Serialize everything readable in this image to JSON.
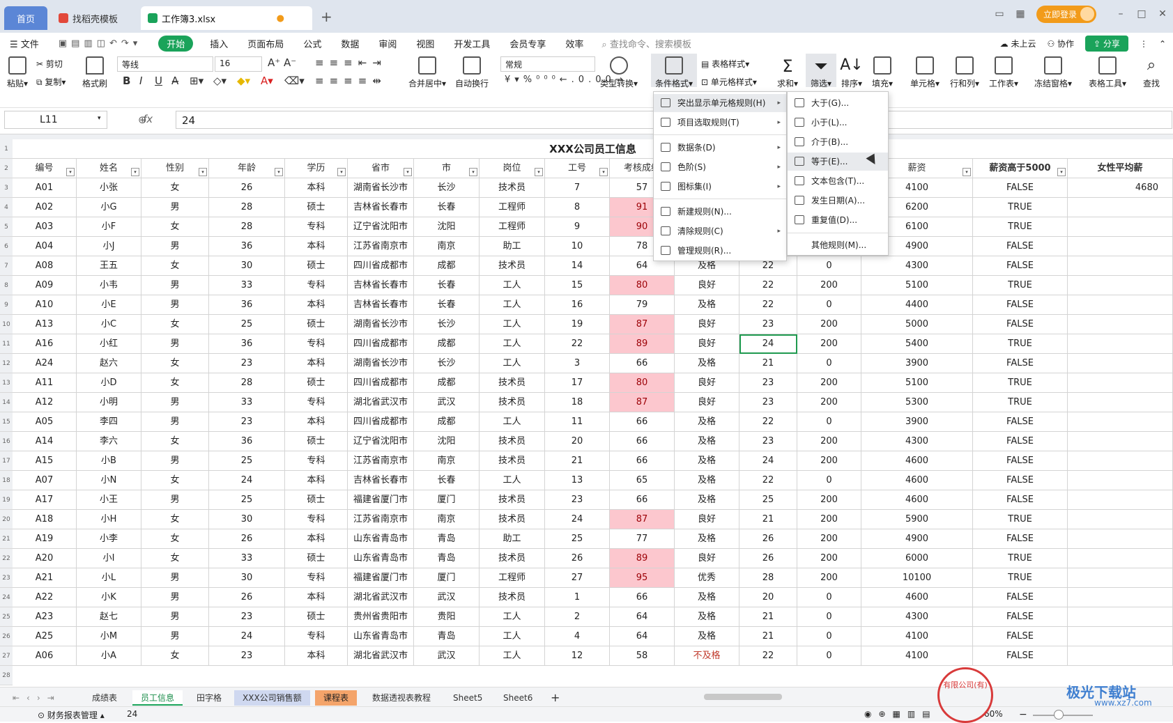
{
  "tabs": {
    "home": "首页",
    "template": "找稻壳模板",
    "file": "工作簿3.xlsx"
  },
  "topbar": {
    "login": "立即登录"
  },
  "menu": {
    "file": "文件",
    "items": [
      "开始",
      "插入",
      "页面布局",
      "公式",
      "数据",
      "审阅",
      "视图",
      "开发工具",
      "会员专享",
      "效率"
    ],
    "search": "查找命令、搜索模板",
    "cloud": "未上云",
    "collab": "协作",
    "share": "分享"
  },
  "ribbon": {
    "paste": "粘贴",
    "cut": "剪切",
    "copy": "复制",
    "format_painter": "格式刷",
    "font": "等线",
    "size": "16",
    "merge": "合并居中",
    "wrap": "自动换行",
    "numfmt": "常规",
    "convert": "类型转换",
    "cond_format": "条件格式",
    "table_style": "表格样式",
    "cell_style": "单元格样式",
    "sum": "求和",
    "filter": "筛选",
    "sort": "排序",
    "fill": "填充",
    "cells": "单元格",
    "rowcol": "行和列",
    "worksheet": "工作表",
    "freeze": "冻结窗格",
    "tabletools": "表格工具",
    "find": "查找"
  },
  "formula": {
    "cell": "L11",
    "fx": "fx",
    "value": "24"
  },
  "sheet": {
    "title": "XXX公司员工信息",
    "headers": [
      "编号",
      "姓名",
      "性别",
      "年龄",
      "学历",
      "省市",
      "市",
      "岗位",
      "工号",
      "考核成绩",
      "",
      "",
      "",
      "薪资",
      "薪资高于5000",
      "女性平均薪"
    ],
    "rows": [
      [
        "A01",
        "小张",
        "女",
        "26",
        "本科",
        "湖南省长沙市",
        "长沙",
        "技术员",
        "7",
        "57",
        "",
        "",
        "",
        "4100",
        "FALSE",
        "4680"
      ],
      [
        "A02",
        "小G",
        "男",
        "28",
        "硕士",
        "吉林省长春市",
        "长春",
        "工程师",
        "8",
        "91",
        "",
        "",
        "",
        "6200",
        "TRUE",
        ""
      ],
      [
        "A03",
        "小F",
        "女",
        "28",
        "专科",
        "辽宁省沈阳市",
        "沈阳",
        "工程师",
        "9",
        "90",
        "",
        "",
        "",
        "6100",
        "TRUE",
        ""
      ],
      [
        "A04",
        "小J",
        "男",
        "36",
        "本科",
        "江苏省南京市",
        "南京",
        "助工",
        "10",
        "78",
        "",
        "",
        "",
        "4900",
        "FALSE",
        ""
      ],
      [
        "A08",
        "王五",
        "女",
        "30",
        "硕士",
        "四川省成都市",
        "成都",
        "技术员",
        "14",
        "64",
        "及格",
        "22",
        "0",
        "4300",
        "FALSE",
        ""
      ],
      [
        "A09",
        "小韦",
        "男",
        "33",
        "专科",
        "吉林省长春市",
        "长春",
        "工人",
        "15",
        "80",
        "良好",
        "22",
        "200",
        "5100",
        "TRUE",
        ""
      ],
      [
        "A10",
        "小E",
        "男",
        "36",
        "本科",
        "吉林省长春市",
        "长春",
        "工人",
        "16",
        "79",
        "及格",
        "22",
        "0",
        "4400",
        "FALSE",
        ""
      ],
      [
        "A13",
        "小C",
        "女",
        "25",
        "硕士",
        "湖南省长沙市",
        "长沙",
        "工人",
        "19",
        "87",
        "良好",
        "23",
        "200",
        "5000",
        "FALSE",
        ""
      ],
      [
        "A16",
        "小红",
        "男",
        "36",
        "专科",
        "四川省成都市",
        "成都",
        "工人",
        "22",
        "89",
        "良好",
        "24",
        "200",
        "5400",
        "TRUE",
        ""
      ],
      [
        "A24",
        "赵六",
        "女",
        "23",
        "本科",
        "湖南省长沙市",
        "长沙",
        "工人",
        "3",
        "66",
        "及格",
        "21",
        "0",
        "3900",
        "FALSE",
        ""
      ],
      [
        "A11",
        "小D",
        "女",
        "28",
        "硕士",
        "四川省成都市",
        "成都",
        "技术员",
        "17",
        "80",
        "良好",
        "23",
        "200",
        "5100",
        "TRUE",
        ""
      ],
      [
        "A12",
        "小明",
        "男",
        "33",
        "专科",
        "湖北省武汉市",
        "武汉",
        "技术员",
        "18",
        "87",
        "良好",
        "23",
        "200",
        "5300",
        "TRUE",
        ""
      ],
      [
        "A05",
        "李四",
        "男",
        "23",
        "本科",
        "四川省成都市",
        "成都",
        "工人",
        "11",
        "66",
        "及格",
        "22",
        "0",
        "3900",
        "FALSE",
        ""
      ],
      [
        "A14",
        "李六",
        "女",
        "36",
        "硕士",
        "辽宁省沈阳市",
        "沈阳",
        "技术员",
        "20",
        "66",
        "及格",
        "23",
        "200",
        "4300",
        "FALSE",
        ""
      ],
      [
        "A15",
        "小B",
        "男",
        "25",
        "专科",
        "江苏省南京市",
        "南京",
        "技术员",
        "21",
        "66",
        "及格",
        "24",
        "200",
        "4600",
        "FALSE",
        ""
      ],
      [
        "A07",
        "小N",
        "女",
        "24",
        "本科",
        "吉林省长春市",
        "长春",
        "工人",
        "13",
        "65",
        "及格",
        "22",
        "0",
        "4600",
        "FALSE",
        ""
      ],
      [
        "A17",
        "小王",
        "男",
        "25",
        "硕士",
        "福建省厦门市",
        "厦门",
        "技术员",
        "23",
        "66",
        "及格",
        "25",
        "200",
        "4600",
        "FALSE",
        ""
      ],
      [
        "A18",
        "小H",
        "女",
        "30",
        "专科",
        "江苏省南京市",
        "南京",
        "技术员",
        "24",
        "87",
        "良好",
        "21",
        "200",
        "5900",
        "TRUE",
        ""
      ],
      [
        "A19",
        "小李",
        "女",
        "26",
        "本科",
        "山东省青岛市",
        "青岛",
        "助工",
        "25",
        "77",
        "及格",
        "26",
        "200",
        "4900",
        "FALSE",
        ""
      ],
      [
        "A20",
        "小I",
        "女",
        "33",
        "硕士",
        "山东省青岛市",
        "青岛",
        "技术员",
        "26",
        "89",
        "良好",
        "26",
        "200",
        "6000",
        "TRUE",
        ""
      ],
      [
        "A21",
        "小L",
        "男",
        "30",
        "专科",
        "福建省厦门市",
        "厦门",
        "工程师",
        "27",
        "95",
        "优秀",
        "28",
        "200",
        "10100",
        "TRUE",
        ""
      ],
      [
        "A22",
        "小K",
        "男",
        "26",
        "本科",
        "湖北省武汉市",
        "武汉",
        "技术员",
        "1",
        "66",
        "及格",
        "20",
        "0",
        "4600",
        "FALSE",
        ""
      ],
      [
        "A23",
        "赵七",
        "男",
        "23",
        "硕士",
        "贵州省贵阳市",
        "贵阳",
        "工人",
        "2",
        "64",
        "及格",
        "21",
        "0",
        "4300",
        "FALSE",
        ""
      ],
      [
        "A25",
        "小M",
        "男",
        "24",
        "专科",
        "山东省青岛市",
        "青岛",
        "工人",
        "4",
        "64",
        "及格",
        "21",
        "0",
        "4100",
        "FALSE",
        ""
      ],
      [
        "A06",
        "小A",
        "女",
        "23",
        "本科",
        "湖北省武汉市",
        "武汉",
        "工人",
        "12",
        "58",
        "不及格",
        "22",
        "0",
        "4100",
        "FALSE",
        ""
      ]
    ]
  },
  "cf_menu": {
    "items": [
      "突出显示单元格规则(H)",
      "项目选取规则(T)",
      "数据条(D)",
      "色阶(S)",
      "图标集(I)",
      "新建规则(N)...",
      "清除规则(C)",
      "管理规则(R)..."
    ]
  },
  "hl_menu": {
    "items": [
      "大于(G)...",
      "小于(L)...",
      "介于(B)...",
      "等于(E)...",
      "文本包含(T)...",
      "发生日期(A)...",
      "重复值(D)...",
      "其他规则(M)..."
    ]
  },
  "sheettabs": [
    "成绩表",
    "员工信息",
    "田字格",
    "XXX公司销售额",
    "课程表",
    "数据透视表教程",
    "Sheet5",
    "Sheet6"
  ],
  "status": {
    "report": "财务报表管理",
    "count": "24",
    "zoom": "60%"
  },
  "watermark": {
    "main": "极光下载站",
    "sub": "www.xz7.com"
  }
}
